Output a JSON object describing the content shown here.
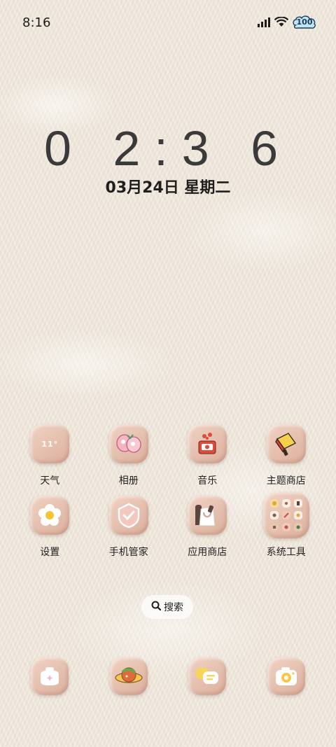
{
  "status_bar": {
    "time": "8:16",
    "battery": "100",
    "icons": [
      "signal-icon",
      "wifi-icon",
      "battery-icon"
    ]
  },
  "clock": {
    "hh": "0 2",
    "separator": ":",
    "mm": "3 6"
  },
  "date": "03月24日 星期二",
  "apps": [
    {
      "label": "天气",
      "icon": "weather-icon",
      "icon_text": "11°"
    },
    {
      "label": "相册",
      "icon": "photos-icon"
    },
    {
      "label": "音乐",
      "icon": "music-icon"
    },
    {
      "label": "主题商店",
      "icon": "theme-store-icon"
    },
    {
      "label": "设置",
      "icon": "settings-icon"
    },
    {
      "label": "手机管家",
      "icon": "phone-manager-icon"
    },
    {
      "label": "应用商店",
      "icon": "app-store-icon"
    },
    {
      "label": "系统工具",
      "icon": "system-tools-folder-icon"
    }
  ],
  "search": {
    "label": "搜索",
    "icon": "search-icon"
  },
  "dock": [
    {
      "icon": "phone-icon"
    },
    {
      "icon": "browser-icon"
    },
    {
      "icon": "messages-icon"
    },
    {
      "icon": "camera-icon"
    }
  ],
  "colors": {
    "wallpaper": "#efe7db",
    "icon_bg": "#e6c0b0",
    "text": "#222222"
  }
}
